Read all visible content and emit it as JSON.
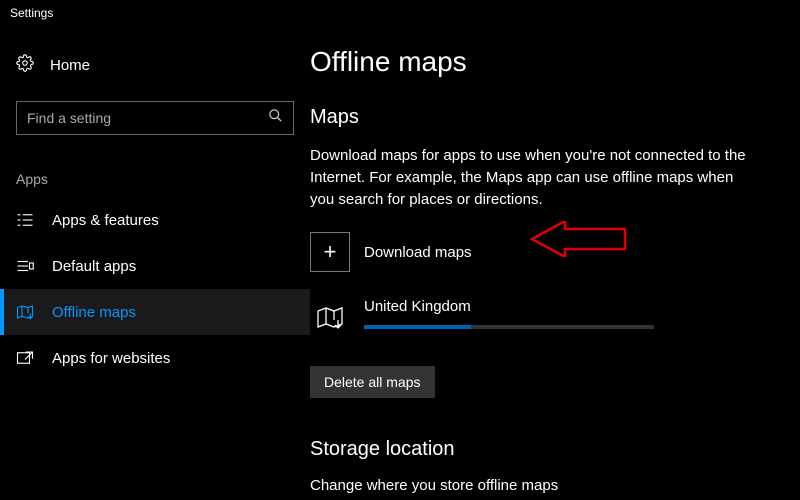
{
  "window": {
    "title": "Settings"
  },
  "sidebar": {
    "home_label": "Home",
    "search_placeholder": "Find a setting",
    "group": "Apps",
    "items": [
      {
        "label": "Apps & features",
        "active": false
      },
      {
        "label": "Default apps",
        "active": false
      },
      {
        "label": "Offline maps",
        "active": true
      },
      {
        "label": "Apps for websites",
        "active": false
      }
    ]
  },
  "main": {
    "title": "Offline maps",
    "maps_section": {
      "heading": "Maps",
      "description": "Download maps for apps to use when you're not connected to the Internet. For example, the Maps app can use offline maps when you search for places or directions.",
      "download_label": "Download maps",
      "item": {
        "name": "United Kingdom",
        "progress_percent": 37
      },
      "delete_label": "Delete all maps"
    },
    "storage_section": {
      "heading": "Storage location",
      "description": "Change where you store offline maps"
    }
  }
}
